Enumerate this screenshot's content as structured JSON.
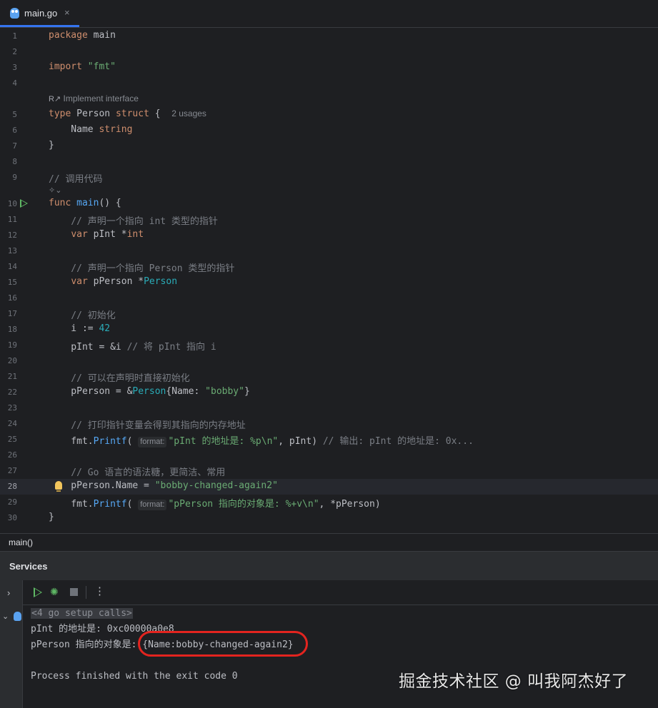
{
  "tab": {
    "label": "main.go",
    "close": "×",
    "icon": "go-gopher-icon"
  },
  "editor": {
    "hints": {
      "implement_interface": "Implement interface",
      "usages": "2 usages",
      "format": "format:"
    },
    "lines": {
      "l1": "1",
      "l2": "2",
      "l3": "3",
      "l4": "4",
      "l5": "5",
      "l6": "6",
      "l7": "7",
      "l8": "8",
      "l9": "9",
      "l10": "10",
      "l11": "11",
      "l12": "12",
      "l13": "13",
      "l14": "14",
      "l15": "15",
      "l16": "16",
      "l17": "17",
      "l18": "18",
      "l19": "19",
      "l20": "20",
      "l21": "21",
      "l22": "22",
      "l23": "23",
      "l24": "24",
      "l25": "25",
      "l26": "26",
      "l27": "27",
      "l28": "28",
      "l29": "29",
      "l30": "30"
    },
    "code": {
      "c1_kw": "package",
      "c1_rest": " main",
      "c3_kw": "import",
      "c3_str": "\"fmt\"",
      "c5_a": "type",
      "c5_b": " Person ",
      "c5_c": "struct",
      "c5_d": " {",
      "c6_a": "    Name ",
      "c6_b": "string",
      "c7": "}",
      "c9": "// 调用代码",
      "c10_a": "func",
      "c10_b": "main",
      "c10_c": "() {",
      "c11": "    // 声明一个指向 int 类型的指针",
      "c12_a": "    ",
      "c12_b": "var",
      "c12_c": " pInt *",
      "c12_d": "int",
      "c14": "    // 声明一个指向 Person 类型的指针",
      "c15_a": "    ",
      "c15_b": "var",
      "c15_c": " pPerson *",
      "c15_d": "Person",
      "c17": "    // 初始化",
      "c18_a": "    i := ",
      "c18_b": "42",
      "c19_a": "    pInt = &i ",
      "c19_b": "// 将 pInt 指向 i",
      "c21": "    // 可以在声明时直接初始化",
      "c22_a": "    pPerson = &",
      "c22_b": "Person",
      "c22_c": "{Name: ",
      "c22_d": "\"bobby\"",
      "c22_e": "}",
      "c24": "    // 打印指针变量会得到其指向的内存地址",
      "c25_a": "    fmt.",
      "c25_b": "Printf",
      "c25_c": "( ",
      "c25_d": "\"pInt 的地址是: %p\\n\"",
      "c25_e": ", pInt) ",
      "c25_f": "// 输出: pInt 的地址是: 0x...",
      "c27": "    // Go 语言的语法糖，更简洁、常用",
      "c28_a": "    pPerson.Name = ",
      "c28_b": "\"bobby-changed-again2\"",
      "c29_a": "    fmt.",
      "c29_b": "Printf",
      "c29_c": "( ",
      "c29_d": "\"pPerson 指向的对象是: %+v\\n\"",
      "c29_e": ", *pPerson)",
      "c30": "}"
    }
  },
  "breadcrumb": "main()",
  "services": {
    "title": "Services",
    "console": {
      "setup": "<4 go setup calls>",
      "line1": "pInt 的地址是: 0xc00000a0e8",
      "line2_a": "pPerson 指向的对象是: ",
      "line2_b": "{Name:bobby-changed-again2}",
      "line3": "Process finished with the exit code 0"
    }
  },
  "watermark": "掘金技术社区 @ 叫我阿杰好了",
  "colors": {
    "accent": "#3574f0",
    "run_green": "#5fb865",
    "annotation_red": "#e3241f"
  }
}
